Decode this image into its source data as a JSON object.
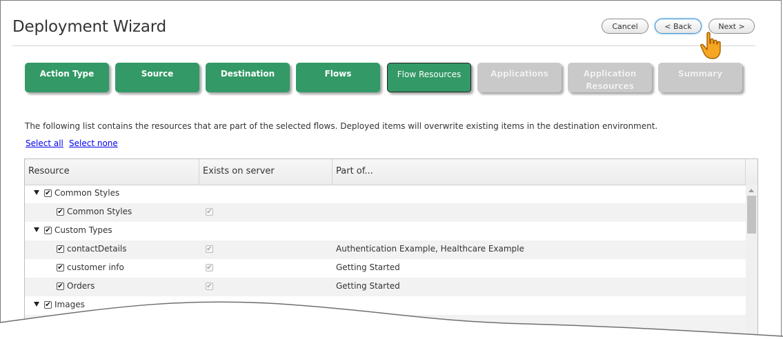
{
  "header": {
    "title": "Deployment Wizard",
    "cancel_label": "Cancel",
    "back_label": "< Back",
    "next_label": "Next >"
  },
  "steps": [
    {
      "label": "Action Type",
      "state": "done"
    },
    {
      "label": "Source",
      "state": "done"
    },
    {
      "label": "Destination",
      "state": "done"
    },
    {
      "label": "Flows",
      "state": "done"
    },
    {
      "label": "Flow Resources",
      "state": "current"
    },
    {
      "label": "Applications",
      "state": "future"
    },
    {
      "label_line1": "Application",
      "label_line2": "Resources",
      "state": "future"
    },
    {
      "label": "Summary",
      "state": "future"
    }
  ],
  "description": "The following list contains the resources that are part of the selected flows. Deployed items will overwrite existing items in the destination environment.",
  "links": {
    "select_all": "Select all",
    "select_none": "Select none"
  },
  "grid": {
    "columns": [
      "Resource",
      "Exists on server",
      "Part of..."
    ],
    "rows": [
      {
        "type": "group",
        "name": "Common Styles",
        "checked": true
      },
      {
        "type": "item",
        "name": "Common Styles",
        "checked": true,
        "exists": true,
        "part_of": ""
      },
      {
        "type": "group",
        "name": "Custom Types",
        "checked": true
      },
      {
        "type": "item",
        "name": "contactDetails",
        "checked": true,
        "exists": true,
        "part_of": "Authentication Example, Healthcare Example"
      },
      {
        "type": "item",
        "name": "customer info",
        "checked": true,
        "exists": true,
        "part_of": "Getting Started"
      },
      {
        "type": "item",
        "name": "Orders",
        "checked": true,
        "exists": true,
        "part_of": "Getting Started"
      },
      {
        "type": "group",
        "name": "Images",
        "checked": true
      }
    ]
  },
  "colors": {
    "step_done": "#339966",
    "step_future": "#c9c9c9",
    "link": "#0000ee",
    "cursor": "#f5a623"
  },
  "icons": {
    "cursor": "hand-pointer-icon",
    "expand": "triangle-down-icon",
    "checkbox": "checkbox-checked-icon",
    "scroll_up": "scroll-up-arrow-icon"
  }
}
